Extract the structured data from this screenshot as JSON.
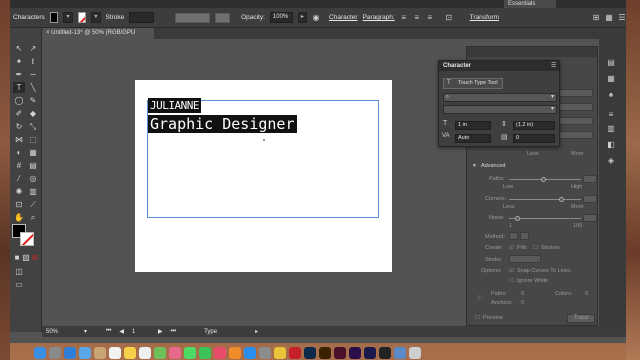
{
  "control_bar": {
    "mode_label": "Characters",
    "stroke_label": "Stroke",
    "opacity_label": "Opacity:",
    "opacity_value": "100%",
    "character_label": "Character",
    "paragraph_label": "Paragraph:",
    "transform_label": "Transform",
    "workspace": "Essentials"
  },
  "document": {
    "tab_title": "Untitled-13* @ 50% (RGB/GPU Preview)"
  },
  "artboard": {
    "line1": "JULIANNE",
    "line2": "Graphic Designer"
  },
  "character_panel": {
    "title": "Character",
    "touch_type_label": "Touch Type Tool",
    "font_size": "1 in",
    "leading": "(1.2 in)",
    "kerning": "Auto",
    "tracking": "0"
  },
  "properties_panel": {
    "less_label": "Less",
    "more_label": "More",
    "advanced_label": "Advanced",
    "paths_label": "Paths:",
    "low_label": "Low",
    "high_label": "High",
    "corners_label": "Corners:",
    "noise_label": "Noise:",
    "noise_min": "1",
    "noise_max": "100",
    "method_label": "Method:",
    "create_label": "Create:",
    "fills_label": "Fills",
    "strokes_label": "Strokes",
    "stroke_label": "Stroke:",
    "options_label": "Options:",
    "snap_label": "Snap Curves To Lines",
    "ignore_white_label": "Ignore White",
    "paths_stat_label": "Paths:",
    "paths_stat": "0",
    "colors_stat_label": "Colors:",
    "colors_stat": "0",
    "anchors_stat_label": "Anchors:",
    "anchors_stat": "0",
    "preview_label": "Preview",
    "trace_label": "Trace"
  },
  "status_bar": {
    "zoom": "50%",
    "artboard_num": "1",
    "mode": "Type"
  },
  "colors": {
    "app_bg": "#535353",
    "panel_bg": "#3f3f3f",
    "selection_highlight": "#111111",
    "text_frame": "#5a8fd6",
    "none_slash": "#e02020"
  }
}
